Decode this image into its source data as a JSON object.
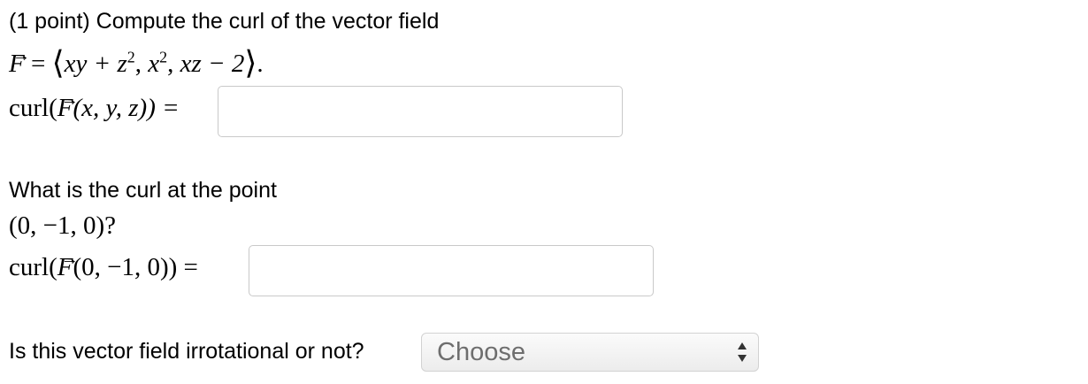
{
  "problem": {
    "intro": "(1 point) Compute the curl of the vector field",
    "field_F": "F",
    "field_equals": " = ",
    "field_comp1": "xy + z",
    "field_comp2": "x",
    "field_comp3": "xz − 2",
    "field_exponent": "2",
    "curl_prefix": "curl(",
    "curl_args": "(x, y, z)) =",
    "curl_answer": ""
  },
  "point_question": {
    "text": "What is the curl at the point",
    "point": "(0, −1, 0)?",
    "curl_prefix": "curl(",
    "curl_args": "(0, −1, 0)) =",
    "curl_answer": ""
  },
  "irrotational_question": {
    "text": "Is this vector field irrotational or not?",
    "selected": "Choose"
  },
  "icons": {
    "select_arrows": "up-down-arrows-icon",
    "vector_arrow": "right-arrow-icon"
  }
}
